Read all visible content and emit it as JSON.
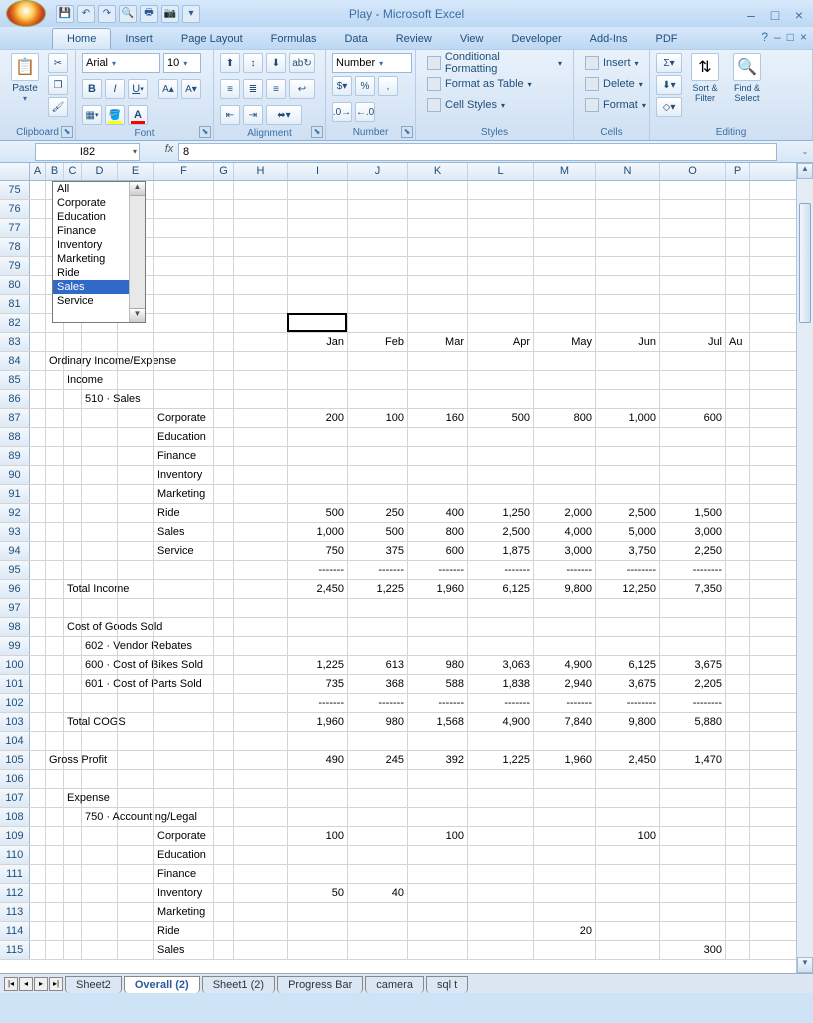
{
  "window": {
    "title": "Play - Microsoft Excel"
  },
  "tabs": [
    "Home",
    "Insert",
    "Page Layout",
    "Formulas",
    "Data",
    "Review",
    "View",
    "Developer",
    "Add-Ins",
    "PDF"
  ],
  "active_tab": "Home",
  "ribbon": {
    "clipboard": {
      "label": "Clipboard",
      "paste": "Paste"
    },
    "font": {
      "label": "Font",
      "name": "Arial",
      "size": "10"
    },
    "alignment": {
      "label": "Alignment"
    },
    "number": {
      "label": "Number",
      "format": "Number"
    },
    "styles": {
      "label": "Styles",
      "cond": "Conditional Formatting",
      "table": "Format as Table",
      "cell": "Cell Styles"
    },
    "cells": {
      "label": "Cells",
      "insert": "Insert",
      "delete": "Delete",
      "format": "Format"
    },
    "editing": {
      "label": "Editing",
      "sort": "Sort & Filter",
      "find": "Find & Select"
    }
  },
  "namebox": "I82",
  "formula": "8",
  "cols": [
    {
      "l": "A",
      "w": 16
    },
    {
      "l": "B",
      "w": 18
    },
    {
      "l": "C",
      "w": 18
    },
    {
      "l": "D",
      "w": 36
    },
    {
      "l": "E",
      "w": 36
    },
    {
      "l": "F",
      "w": 60
    },
    {
      "l": "G",
      "w": 20
    },
    {
      "l": "H",
      "w": 54
    },
    {
      "l": "I",
      "w": 60
    },
    {
      "l": "J",
      "w": 60
    },
    {
      "l": "K",
      "w": 60
    },
    {
      "l": "L",
      "w": 66
    },
    {
      "l": "M",
      "w": 62
    },
    {
      "l": "N",
      "w": 64
    },
    {
      "l": "O",
      "w": 66
    },
    {
      "l": "P",
      "w": 24
    }
  ],
  "listbox": {
    "items": [
      "All",
      "Corporate",
      "Education",
      "Finance",
      "Inventory",
      "Marketing",
      "Ride",
      "Sales",
      "Service"
    ],
    "selected": "Sales"
  },
  "rows": [
    {
      "r": 75
    },
    {
      "r": 76
    },
    {
      "r": 77
    },
    {
      "r": 78
    },
    {
      "r": 79
    },
    {
      "r": 80
    },
    {
      "r": 81
    },
    {
      "r": 82,
      "c": {
        "I": "8"
      }
    },
    {
      "r": 83,
      "c": {
        "I": "Jan",
        "J": "Feb",
        "K": "Mar",
        "L": "Apr",
        "M": "May",
        "N": "Jun",
        "O": "Jul",
        "P": "Au"
      }
    },
    {
      "r": 84,
      "c": {
        "B": "Ordinary Income/Expense"
      },
      "span": "B"
    },
    {
      "r": 85,
      "c": {
        "C": "Income"
      },
      "span": "C"
    },
    {
      "r": 86,
      "c": {
        "D": "510 · Sales"
      },
      "span": "D"
    },
    {
      "r": 87,
      "c": {
        "F": "Corporate",
        "I": "200",
        "J": "100",
        "K": "160",
        "L": "500",
        "M": "800",
        "N": "1,000",
        "O": "600"
      }
    },
    {
      "r": 88,
      "c": {
        "F": "Education"
      }
    },
    {
      "r": 89,
      "c": {
        "F": "Finance"
      }
    },
    {
      "r": 90,
      "c": {
        "F": "Inventory"
      }
    },
    {
      "r": 91,
      "c": {
        "F": "Marketing"
      }
    },
    {
      "r": 92,
      "c": {
        "F": "Ride",
        "I": "500",
        "J": "250",
        "K": "400",
        "L": "1,250",
        "M": "2,000",
        "N": "2,500",
        "O": "1,500"
      }
    },
    {
      "r": 93,
      "c": {
        "F": "Sales",
        "I": "1,000",
        "J": "500",
        "K": "800",
        "L": "2,500",
        "M": "4,000",
        "N": "5,000",
        "O": "3,000"
      }
    },
    {
      "r": 94,
      "c": {
        "F": "Service",
        "I": "750",
        "J": "375",
        "K": "600",
        "L": "1,875",
        "M": "3,000",
        "N": "3,750",
        "O": "2,250"
      }
    },
    {
      "r": 95,
      "c": {
        "I": "-------",
        "J": "-------",
        "K": "-------",
        "L": "-------",
        "M": "-------",
        "N": "--------",
        "O": "--------"
      }
    },
    {
      "r": 96,
      "c": {
        "C": "Total Income",
        "I": "2,450",
        "J": "1,225",
        "K": "1,960",
        "L": "6,125",
        "M": "9,800",
        "N": "12,250",
        "O": "7,350"
      },
      "span": "C"
    },
    {
      "r": 97
    },
    {
      "r": 98,
      "c": {
        "C": "Cost of Goods Sold"
      },
      "span": "C"
    },
    {
      "r": 99,
      "c": {
        "D": "602 · Vendor Rebates"
      },
      "span": "D"
    },
    {
      "r": 100,
      "c": {
        "D": "600 · Cost of Bikes Sold",
        "I": "1,225",
        "J": "613",
        "K": "980",
        "L": "3,063",
        "M": "4,900",
        "N": "6,125",
        "O": "3,675"
      },
      "span": "D"
    },
    {
      "r": 101,
      "c": {
        "D": "601 · Cost of Parts Sold",
        "I": "735",
        "J": "368",
        "K": "588",
        "L": "1,838",
        "M": "2,940",
        "N": "3,675",
        "O": "2,205"
      },
      "span": "D"
    },
    {
      "r": 102,
      "c": {
        "I": "-------",
        "J": "-------",
        "K": "-------",
        "L": "-------",
        "M": "-------",
        "N": "--------",
        "O": "--------"
      }
    },
    {
      "r": 103,
      "c": {
        "C": "Total COGS",
        "I": "1,960",
        "J": "980",
        "K": "1,568",
        "L": "4,900",
        "M": "7,840",
        "N": "9,800",
        "O": "5,880"
      },
      "span": "C"
    },
    {
      "r": 104
    },
    {
      "r": 105,
      "c": {
        "B": "Gross Profit",
        "I": "490",
        "J": "245",
        "K": "392",
        "L": "1,225",
        "M": "1,960",
        "N": "2,450",
        "O": "1,470"
      },
      "span": "B"
    },
    {
      "r": 106
    },
    {
      "r": 107,
      "c": {
        "C": "Expense"
      },
      "span": "C"
    },
    {
      "r": 108,
      "c": {
        "D": "750 · Accounting/Legal"
      },
      "span": "D"
    },
    {
      "r": 109,
      "c": {
        "F": "Corporate",
        "I": "100",
        "K": "100",
        "N": "100"
      }
    },
    {
      "r": 110,
      "c": {
        "F": "Education"
      }
    },
    {
      "r": 111,
      "c": {
        "F": "Finance"
      }
    },
    {
      "r": 112,
      "c": {
        "F": "Inventory",
        "I": "50",
        "J": "40"
      }
    },
    {
      "r": 113,
      "c": {
        "F": "Marketing"
      }
    },
    {
      "r": 114,
      "c": {
        "F": "Ride",
        "M": "20"
      }
    },
    {
      "r": 115,
      "c": {
        "F": "Sales",
        "O": "300"
      }
    }
  ],
  "sheets": [
    "Sheet2",
    "Overall (2)",
    "Sheet1 (2)",
    "Progress Bar",
    "camera",
    "sql t"
  ],
  "active_sheet": "Overall (2)",
  "active_cell": {
    "row": 82,
    "col": "I"
  }
}
